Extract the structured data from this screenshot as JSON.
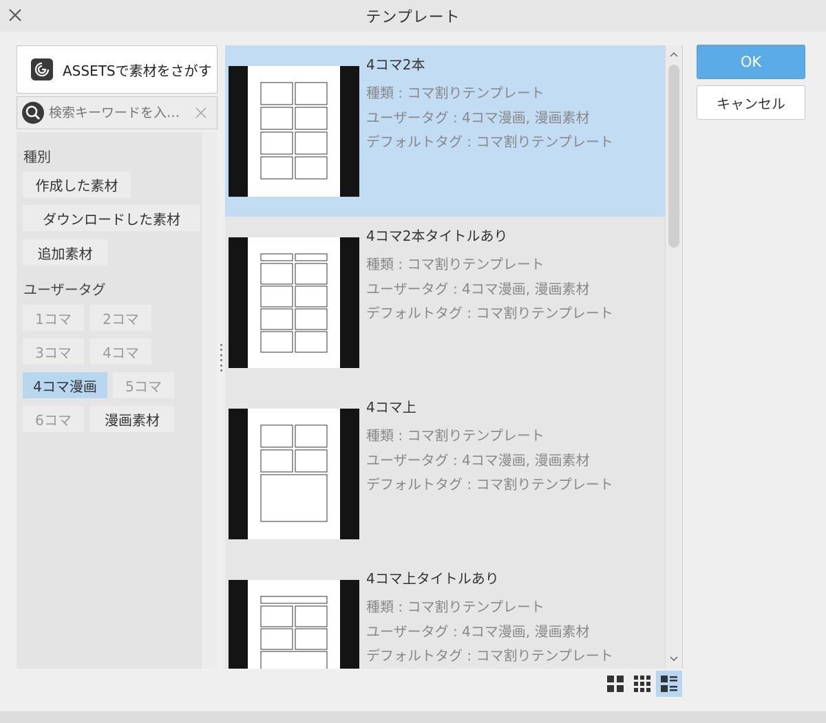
{
  "window": {
    "title": "テンプレート"
  },
  "assets": {
    "label": "ASSETSで素材をさがす"
  },
  "search": {
    "placeholder": "検索キーワードを入…"
  },
  "filters": {
    "category_heading": "種別",
    "category_items": [
      {
        "label": "作成した素材"
      },
      {
        "label": "ダウンロードした素材"
      },
      {
        "label": "追加素材"
      }
    ],
    "user_tag_heading": "ユーザータグ",
    "user_tags": [
      {
        "label": "1コマ",
        "selected": false
      },
      {
        "label": "2コマ",
        "selected": false
      },
      {
        "label": "3コマ",
        "selected": false
      },
      {
        "label": "4コマ",
        "selected": false
      },
      {
        "label": "4コマ漫画",
        "selected": true
      },
      {
        "label": "5コマ",
        "selected": false
      },
      {
        "label": "6コマ",
        "selected": false
      },
      {
        "label": "漫画素材",
        "selected": false
      }
    ]
  },
  "items": [
    {
      "title": "4コマ2本",
      "type": "種類 : コマ割りテンプレート",
      "user_tags": "ユーザータグ : 4コマ漫画, 漫画素材",
      "default_tags": "デフォルトタグ : コマ割りテンプレート",
      "selected": true
    },
    {
      "title": "4コマ2本タイトルあり",
      "type": "種類 : コマ割りテンプレート",
      "user_tags": "ユーザータグ : 4コマ漫画, 漫画素材",
      "default_tags": "デフォルトタグ : コマ割りテンプレート",
      "selected": false
    },
    {
      "title": "4コマ上",
      "type": "種類 : コマ割りテンプレート",
      "user_tags": "ユーザータグ : 4コマ漫画, 漫画素材",
      "default_tags": "デフォルトタグ : コマ割りテンプレート",
      "selected": false
    },
    {
      "title": "4コマ上タイトルあり",
      "type": "種類 : コマ割りテンプレート",
      "user_tags": "ユーザータグ : 4コマ漫画, 漫画素材",
      "default_tags": "デフォルトタグ : コマ割りテンプレート",
      "selected": false
    }
  ],
  "view_modes": {
    "active": "detail-list"
  },
  "buttons": {
    "ok": "OK",
    "cancel": "キャンセル"
  },
  "colors": {
    "accent": "#5aabe6",
    "selection": "#c2dcf4",
    "tag_selected": "#b7d6ef"
  }
}
